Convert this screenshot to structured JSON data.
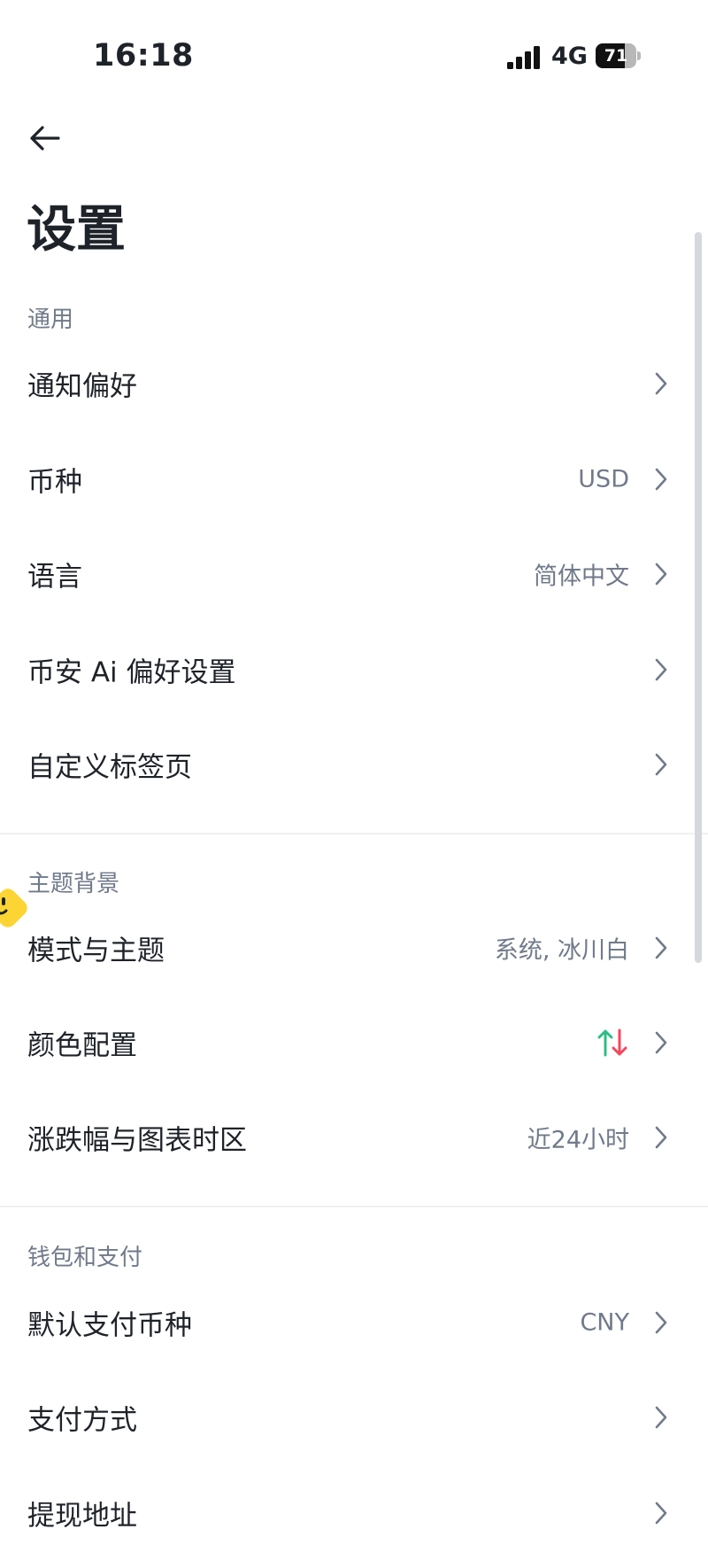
{
  "status_bar": {
    "time": "16:18",
    "network": "4G",
    "battery": "71",
    "battery_level": 0.71
  },
  "header": {
    "back_icon": "arrow-left-icon",
    "title": "设置"
  },
  "sections": [
    {
      "label": "通用",
      "items": [
        {
          "label": "通知偏好",
          "value": ""
        },
        {
          "label": "币种",
          "value": "USD"
        },
        {
          "label": "语言",
          "value": "简体中文"
        },
        {
          "label": "币安 Ai 偏好设置",
          "value": ""
        },
        {
          "label": "自定义标签页",
          "value": ""
        }
      ]
    },
    {
      "label": "主题背景",
      "items": [
        {
          "label": "模式与主题",
          "value": "系统, 冰川白"
        },
        {
          "label": "颜色配置",
          "value": "",
          "icon": "up-down-arrows-icon",
          "up_color": "#2ebd85",
          "down_color": "#f6465d"
        },
        {
          "label": "涨跌幅与图表时区",
          "value": "近24小时"
        }
      ]
    },
    {
      "label": "钱包和支付",
      "items": [
        {
          "label": "默认支付币种",
          "value": "CNY"
        },
        {
          "label": "支付方式",
          "value": ""
        },
        {
          "label": "提现地址",
          "value": ""
        }
      ]
    }
  ],
  "colors": {
    "text_primary": "#1e2329",
    "text_secondary": "#707a8a",
    "accent_yellow": "#fcd535",
    "up_green": "#2ebd85",
    "down_red": "#f6465d"
  }
}
